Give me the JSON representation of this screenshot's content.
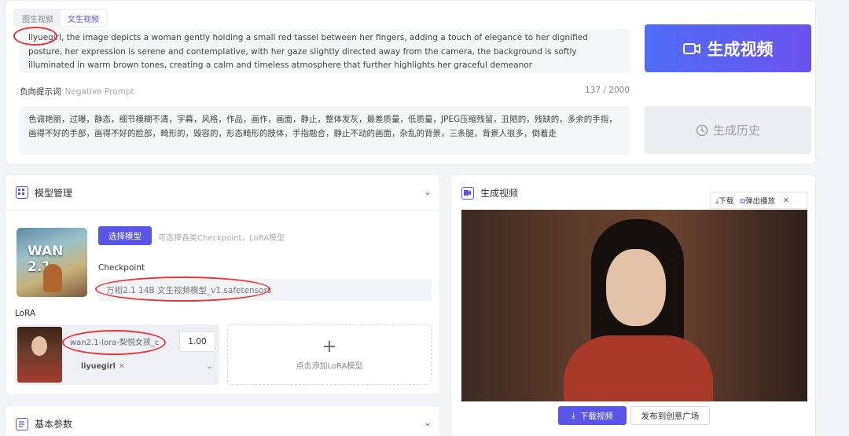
{
  "tabs": [
    {
      "label": "图生视频",
      "active": false
    },
    {
      "label": "文生视频",
      "active": true
    }
  ],
  "prompt": {
    "text": "liyuegirl, the image depicts a woman gently holding a small red tassel between her fingers, adding a touch of elegance to her dignified posture, her expression is serene and contemplative, with her gaze slightly directed away from the camera, the background is softly illuminated in warm brown tones, creating a calm and timeless atmosphere that further highlights her graceful demeanor"
  },
  "negative": {
    "label": "负向提示词",
    "label_en": "Negative Prompt",
    "count": "137 / 2000",
    "text": "色调艳丽，过曝，静态，细节模糊不清，字幕，风格，作品，画作，画面，静止，整体发灰，最差质量，低质量，JPEG压缩残留，丑陋的，残缺的，多余的手指，画得不好的手部，画得不好的脸部，畸形的，毁容的，形态畸形的肢体，手指融合，静止不动的画面，杂乱的背景，三条腿，背景人很多，倒着走"
  },
  "actions": {
    "generate_label": "生成视频",
    "history_label": "生成历史"
  },
  "model": {
    "title": "模型管理",
    "thumb_text": "WAN 2.1",
    "select_label": "选择模型",
    "select_hint": "可选择各类Checkpoint，LoRA模型",
    "checkpoint_label": "Checkpoint",
    "checkpoint_value": "万相2.1 14B 文生视频模型_v1.safetensors",
    "lora_label": "LoRA",
    "lora_name": "wan2.1-lora-梨悦女孩_c",
    "lora_weight": "1.00",
    "lora_tag": "liyuegirl",
    "lora_tag_close": "✕",
    "add_lora_label": "点击添加LoRA模型"
  },
  "basic": {
    "title": "基本参数"
  },
  "video": {
    "title": "生成视频",
    "toolbar_download": "下载",
    "toolbar_popout": "弹出播放",
    "toolbar_close": "✕",
    "download_label": "下载视频",
    "publish_label": "发布到创意广场"
  },
  "icons": {
    "chevron": "chevron-down-icon",
    "model": "grid-icon",
    "video": "video-camera-icon",
    "history": "clock-icon",
    "download": "download-icon",
    "basic": "document-icon"
  },
  "colors": {
    "accent": "#5a55e8",
    "gradient_start": "#4f6ef7",
    "gradient_end": "#6c52ee",
    "annotation": "#e4383a"
  }
}
